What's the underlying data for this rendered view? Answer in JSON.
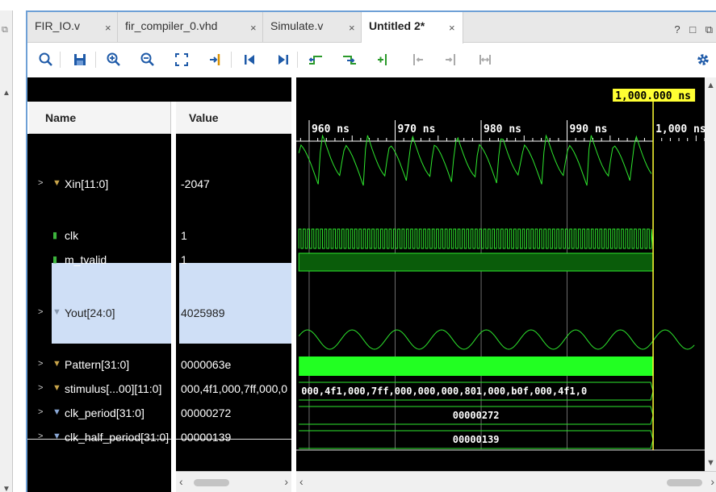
{
  "tabs": [
    {
      "label": "FIR_IO.v",
      "close": "×",
      "active": false
    },
    {
      "label": "fir_compiler_0.vhd",
      "close": "×",
      "active": false
    },
    {
      "label": "Simulate.v",
      "close": "×",
      "active": false
    },
    {
      "label": "Untitled 2*",
      "close": "×",
      "active": true
    }
  ],
  "window_controls": {
    "help": "?",
    "minimize": "□",
    "restore": "⧉"
  },
  "toolbar": {
    "zoom_search": "search-icon",
    "save": "save-icon",
    "zoom_in": "zoom-in-icon",
    "zoom_out": "zoom-out-icon",
    "zoom_fit": "zoom-fit-icon",
    "go_to_cursor": "go-to-cursor-icon",
    "go_to_start": "go-to-start-icon",
    "go_to_end": "go-to-end-icon",
    "prev_transition": "previous-transition-icon",
    "next_transition": "next-transition-icon",
    "add_marker": "add-marker-icon",
    "prev_marker": "previous-marker-icon",
    "next_marker": "next-marker-icon",
    "swap_cursors": "swap-cursors-icon",
    "settings": "gear-icon"
  },
  "columns": {
    "name": "Name",
    "value": "Value"
  },
  "signals": [
    {
      "name": "Xin[11:0]",
      "value": "-2047",
      "expandable": true,
      "icon": "bus-icon"
    },
    {
      "name": "clk",
      "value": "1",
      "expandable": false,
      "icon": "bit-icon"
    },
    {
      "name": "m_tvalid",
      "value": "1",
      "expandable": false,
      "icon": "bit-icon"
    },
    {
      "name": "Yout[24:0]",
      "value": "4025989",
      "expandable": true,
      "icon": "bus-icon",
      "selected": true
    },
    {
      "name": "Pattern[31:0]",
      "value": "0000063e",
      "expandable": true,
      "icon": "bus-icon"
    },
    {
      "name": "stimulus[...00][11:0]",
      "value": "000,4f1,000,7ff,000,0",
      "expandable": true,
      "icon": "bus-icon"
    },
    {
      "name": "clk_period[31:0]",
      "value": "00000272",
      "expandable": true,
      "icon": "parameter-icon"
    },
    {
      "name": "clk_half_period[31:0]",
      "value": "00000139",
      "expandable": true,
      "icon": "parameter-icon"
    }
  ],
  "waveform": {
    "cursor_label": "1,000.000 ns",
    "time_axis": {
      "unit": "ns",
      "start": 958.5,
      "end": 1006,
      "ticks": [
        960,
        970,
        980,
        990,
        1000
      ],
      "tick_labels": [
        "960 ns",
        "970 ns",
        "980 ns",
        "990 ns",
        "1,000 ns"
      ]
    },
    "cursor_time": 1000,
    "bus_labels": {
      "stimulus": "000,4f1,000,7ff,000,000,000,801,000,b0f,000,4f1,0",
      "clk_period": "00000272",
      "clk_half_period": "00000139"
    },
    "colors": {
      "wave": "#2ee82e",
      "cursor": "#ffff33",
      "cursor_label_bg": "#ffff33",
      "grid": "#ffffff",
      "fill": "#0a5c0a",
      "bright": "#22ff22"
    }
  }
}
